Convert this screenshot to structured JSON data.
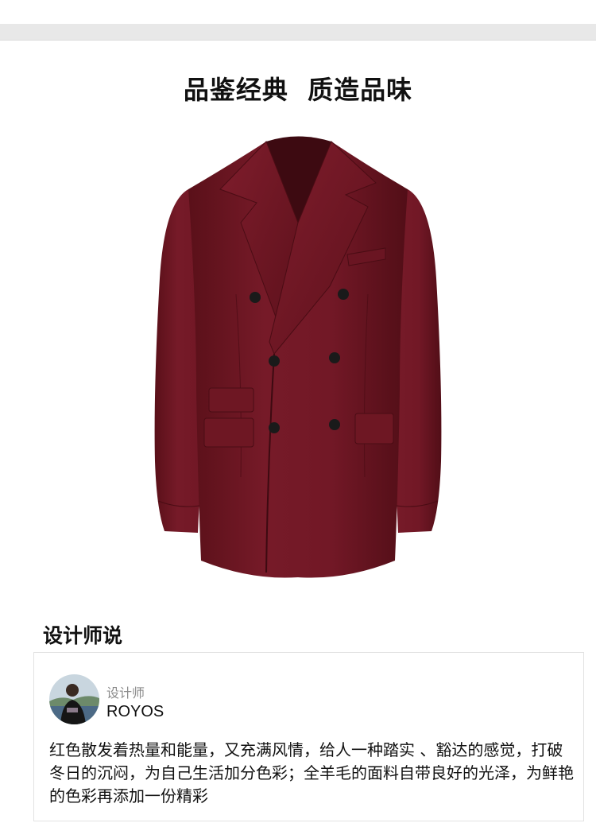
{
  "page": {
    "headline": "品鉴经典  质造品味"
  },
  "product": {
    "image_alt": "酒红色双排扣西装",
    "color": "#6e1624"
  },
  "designer_section": {
    "title": "设计师说",
    "role_label": "设计师",
    "name": "ROYOS",
    "quote": "红色散发着热量和能量，又充满风情，给人一种踏实 、豁达的感觉，打破冬日的沉闷，为自己生活加分色彩；全羊毛的面料自带良好的光泽，为鲜艳的色彩再添加一份精彩"
  }
}
